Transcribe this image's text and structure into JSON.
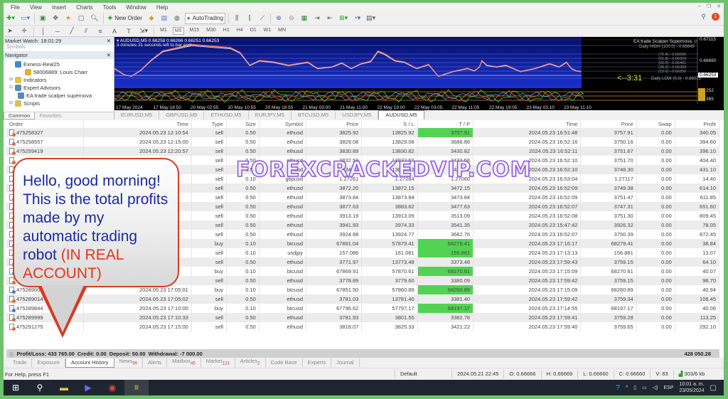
{
  "menu": [
    "File",
    "View",
    "Insert",
    "Charts",
    "Tools",
    "Window",
    "Help"
  ],
  "toolbar": {
    "new_order": "New Order",
    "auto_trading": "AutoTrading",
    "notification_count": "1"
  },
  "timeframes": [
    "M1",
    "M5",
    "M15",
    "M30",
    "H1",
    "H4",
    "D1",
    "W1",
    "MN"
  ],
  "active_timeframe": "M5",
  "market_watch": {
    "title": "Market Watch: 18:01:29",
    "tabs": [
      "Symbols",
      "Tick Chart"
    ]
  },
  "navigator": {
    "title": "Navigator",
    "items": [
      {
        "label": "Exness-Real25",
        "icon": "server-icon"
      },
      {
        "label": "58006889: Louis Charr",
        "icon": "account-icon"
      },
      {
        "label": "Indicators",
        "icon": "indicator-icon"
      },
      {
        "label": "Expert Advisors",
        "icon": "expert-icon"
      },
      {
        "label": "EA trade scalper supernova",
        "icon": "expert-icon"
      },
      {
        "label": "Scripts",
        "icon": "script-icon"
      }
    ],
    "tabs": [
      "Common",
      "Favorites"
    ]
  },
  "chart": {
    "header": "AUDUSD,M5  0.66258 0.66266 0.66251 0.66253",
    "subheader": "3 minutes 31 seconds left to bar end",
    "ea_label": "EA trade Scalper Supernova",
    "daily_high": "Daily HIGH (100.0) - 0.66849",
    "daily_low": "Daily LOW (0.0) - 0.66073",
    "fib_levels": [
      "(76.4) - 0.66666",
      "(61.8) - 0.66553",
      "(50.0) - 0.66461",
      "(38.2) - 0.66369",
      "(23.6) - 0.66256"
    ],
    "countdown": "<--3:31",
    "price_labels": [
      "0.67115",
      "0.66660",
      "0.66253"
    ],
    "current_price": "0.66253",
    "indicator_labels": [
      "252",
      "369"
    ],
    "time_labels": [
      "17 May 2024",
      "17 May 18:50",
      "20 May 02:55",
      "20 May 10:55",
      "20 May 18:55",
      "21 May 03:00",
      "21 May 11:00",
      "21 May 19:00",
      "22 May 03:05",
      "22 May 11:05",
      "22 May 19:05",
      "23 May 03:10",
      "23 May 11:10"
    ],
    "tabs": [
      "EURUSD,M5",
      "GBPUSD,M5",
      "ETHUSD,M5",
      "EURJPY,M5",
      "BTCUSD,M5",
      "USDJPY,M5",
      "AUDUSD,M5"
    ],
    "active_tab": "AUDUSD,M5"
  },
  "orders": {
    "columns": [
      "Order",
      "Time",
      "Type",
      "Size",
      "Symbol",
      "Price",
      "S / L",
      "T / P",
      "Time",
      "Price",
      "Swap",
      "Profit"
    ],
    "rows": [
      {
        "order": "475258327",
        "open_time": "2024.05.23 12:10:54",
        "type": "sell",
        "size": "0.50",
        "symbol": "ethusd",
        "price": "3825.92",
        "sl": "13825.92",
        "tp": "3757.91",
        "tp_hit": true,
        "close_time": "2024.05.23 16:51:48",
        "close_price": "3757.91",
        "swap": "0.00",
        "profit": "340.05"
      },
      {
        "order": "475258557",
        "open_time": "2024.05.23 12:15:00",
        "type": "sell",
        "size": "0.50",
        "symbol": "ethusd",
        "price": "3829.08",
        "sl": "13829.08",
        "tp": "3686.86",
        "tp_hit": false,
        "close_time": "2024.05.23 16:52:16",
        "close_price": "3750.16",
        "swap": "0.00",
        "profit": "394.60"
      },
      {
        "order": "475259419",
        "open_time": "2024.05.23 12:20:57",
        "type": "sell",
        "size": "0.50",
        "symbol": "ethusd",
        "price": "3830.89",
        "sl": "13830.82",
        "tp": "3430.82",
        "tp_hit": false,
        "close_time": "2024.05.23 16:52:11",
        "close_price": "3751.67",
        "swap": "0.00",
        "profit": "396.10"
      },
      {
        "order": "",
        "open_time": "",
        "type": "sell",
        "size": "0.50",
        "symbol": "ethusd",
        "price": "3832.58",
        "sl": "13832.58",
        "tp": "3432.58",
        "tp_hit": false,
        "close_time": "2024.05.23 16:52:10",
        "close_price": "3751.70",
        "swap": "0.00",
        "profit": "404.40"
      },
      {
        "order": "",
        "open_time": "",
        "type": "sell",
        "size": "0.50",
        "symbol": "ethusd",
        "price": "3834.52",
        "sl": "13834.52",
        "tp": "3434.52",
        "tp_hit": false,
        "close_time": "2024.05.23 16:52:10",
        "close_price": "3748.30",
        "swap": "0.00",
        "profit": "431.10"
      },
      {
        "order": "",
        "open_time": "",
        "type": "sell",
        "size": "0.10",
        "symbol": "gbpusd",
        "price": "1.27261",
        "sl": "1.27284",
        "tp": "1.27060",
        "tp_hit": false,
        "close_time": "2024.05.23 16:53:04",
        "close_price": "1.27117",
        "swap": "0.00",
        "profit": "14.40"
      },
      {
        "order": "",
        "open_time": "",
        "type": "sell",
        "size": "0.50",
        "symbol": "ethusd",
        "price": "3872.20",
        "sl": "13872.15",
        "tp": "3472.15",
        "tp_hit": false,
        "close_time": "2024.05.23 16:52:09",
        "close_price": "3749.38",
        "swap": "0.00",
        "profit": "614.10"
      },
      {
        "order": "",
        "open_time": "",
        "type": "sell",
        "size": "0.50",
        "symbol": "ethusd",
        "price": "3873.84",
        "sl": "13873.84",
        "tp": "3473.84",
        "tp_hit": false,
        "close_time": "2024.05.23 16:52:09",
        "close_price": "3751.47",
        "swap": "0.00",
        "profit": "611.85"
      },
      {
        "order": "",
        "open_time": "",
        "type": "sell",
        "size": "0.50",
        "symbol": "ethusd",
        "price": "3877.63",
        "sl": "3883.62",
        "tp": "3477.63",
        "tp_hit": false,
        "close_time": "2024.05.23 16:52:07",
        "close_price": "3747.31",
        "swap": "0.00",
        "profit": "651.60"
      },
      {
        "order": "",
        "open_time": "",
        "type": "sell",
        "size": "0.50",
        "symbol": "ethusd",
        "price": "3913.19",
        "sl": "13913.09",
        "tp": "3513.09",
        "tp_hit": false,
        "close_time": "2024.05.23 16:52:08",
        "close_price": "3751.30",
        "swap": "0.00",
        "profit": "809.45"
      },
      {
        "order": "",
        "open_time": "",
        "type": "sell",
        "size": "0.50",
        "symbol": "ethusd",
        "price": "3941.93",
        "sl": "3974.33",
        "tp": "3541.35",
        "tp_hit": false,
        "close_time": "2024.05.23 15:47:42",
        "close_price": "3926.32",
        "swap": "0.00",
        "profit": "78.05"
      },
      {
        "order": "",
        "open_time": "",
        "type": "sell",
        "size": "0.50",
        "symbol": "ethusd",
        "price": "3924.88",
        "sl": "13924.77",
        "tp": "3682.76",
        "tp_hit": false,
        "close_time": "2024.05.23 16:52:07",
        "close_price": "3750.39",
        "swap": "0.00",
        "profit": "872.45"
      },
      {
        "order": "",
        "open_time": "",
        "type": "buy",
        "size": "0.10",
        "symbol": "btcusd",
        "price": "67891.04",
        "sl": "57879.41",
        "tp": "68279.41",
        "tp_hit": true,
        "close_time": "2024.05.23 17:16:17",
        "close_price": "68279.41",
        "swap": "0.00",
        "profit": "38.84"
      },
      {
        "order": "",
        "open_time": "",
        "type": "sell",
        "size": "0.10",
        "symbol": "usdjpy",
        "price": "157.086",
        "sl": "161.081",
        "tp": "156.881",
        "tp_hit": true,
        "close_time": "2024.05.23 17:13:13",
        "close_price": "156.881",
        "swap": "0.00",
        "profit": "13.07"
      },
      {
        "order": "",
        "open_time": "",
        "type": "sell",
        "size": "0.50",
        "symbol": "ethusd",
        "price": "3771.97",
        "sl": "13773.48",
        "tp": "3373.48",
        "tp_hit": false,
        "close_time": "2024.05.23 17:59:43",
        "close_price": "3759.15",
        "swap": "0.00",
        "profit": "64.10"
      },
      {
        "order": "",
        "open_time": "",
        "type": "buy",
        "size": "0.10",
        "symbol": "btcusd",
        "price": "67869.91",
        "sl": "57870.61",
        "tp": "68270.61",
        "tp_hit": true,
        "close_time": "2024.05.23 17:15:09",
        "close_price": "68270.61",
        "swap": "0.00",
        "profit": "40.07"
      },
      {
        "order": "",
        "open_time": "",
        "type": "sell",
        "size": "0.50",
        "symbol": "ethusd",
        "price": "3778.89",
        "sl": "3779.60",
        "tp": "3380.09",
        "tp_hit": false,
        "close_time": "2024.05.23 17:59:42",
        "close_price": "3759.15",
        "swap": "0.00",
        "profit": "98.70"
      },
      {
        "order": "475289007",
        "open_time": "2024.05.23 17:05:01",
        "type": "buy",
        "size": "0.10",
        "symbol": "btcusd",
        "price": "67851.50",
        "sl": "57860.89",
        "tp": "68260.89",
        "tp_hit": true,
        "close_time": "2024.05.23 17:15:09",
        "close_price": "68260.89",
        "swap": "0.00",
        "profit": "40.94"
      },
      {
        "order": "475289014",
        "open_time": "2024.05.23 17:05:02",
        "type": "sell",
        "size": "0.50",
        "symbol": "ethusd",
        "price": "3781.03",
        "sl": "13781.40",
        "tp": "3381.40",
        "tp_hit": false,
        "close_time": "2024.05.23 17:59:42",
        "close_price": "3759.34",
        "swap": "0.00",
        "profit": "108.45"
      },
      {
        "order": "475289844",
        "open_time": "2024.05.23 17:10:00",
        "type": "buy",
        "size": "0.10",
        "symbol": "btcusd",
        "price": "67796.62",
        "sl": "57797.17",
        "tp": "68197.17",
        "tp_hit": true,
        "close_time": "2024.05.23 17:14:55",
        "close_price": "68197.17",
        "swap": "0.00",
        "profit": "40.06"
      },
      {
        "order": "475289999",
        "open_time": "2024.05.23 17:10:33",
        "type": "sell",
        "size": "0.50",
        "symbol": "ethusd",
        "price": "3781.93",
        "sl": "3801.55",
        "tp": "3382.78",
        "tp_hit": false,
        "close_time": "2024.05.23 17:59:41",
        "close_price": "3759.28",
        "swap": "0.00",
        "profit": "113.25"
      },
      {
        "order": "475291275",
        "open_time": "2024.05.23 17:15:00",
        "type": "sell",
        "size": "0.50",
        "symbol": "ethusd",
        "price": "3818.07",
        "sl": "3825.33",
        "tp": "3421.22",
        "tp_hit": false,
        "close_time": "2024.05.23 17:59:40",
        "close_price": "3759.65",
        "swap": "0.00",
        "profit": "292.10"
      }
    ],
    "summary": {
      "profit_loss": "Profit/Loss: 433 765.00",
      "credit": "Credit: 0.00",
      "deposit": "Deposit:   50.00",
      "withdrawal": "Withdrawal: -7 000.00",
      "total": "428 050.28"
    }
  },
  "terminal_tabs": [
    {
      "label": "Trade",
      "count": ""
    },
    {
      "label": "Exposure",
      "count": ""
    },
    {
      "label": "Account History",
      "count": "",
      "active": true
    },
    {
      "label": "News",
      "count": "99"
    },
    {
      "label": "Alerts",
      "count": ""
    },
    {
      "label": "Mailbox",
      "count": "45"
    },
    {
      "label": "Market",
      "count": "123"
    },
    {
      "label": "Articles",
      "count": "2"
    },
    {
      "label": "Code Base",
      "count": ""
    },
    {
      "label": "Experts",
      "count": ""
    },
    {
      "label": "Journal",
      "count": ""
    }
  ],
  "statusbar": {
    "help": "For Help, press F1",
    "profile": "Default",
    "bar_time": "2024.05.21 22:45",
    "open": "O: 0.66666",
    "high": "H: 0.66669",
    "low": "L: 0.66660",
    "close": "C: 0.66660",
    "volume": "V: 83",
    "traffic": "303/6 kb"
  },
  "overlay": {
    "bubble_text": "Hello, good morning! This is the total profits made by my automatic trading robot ",
    "bubble_highlight": "(IN REAL ACCOUNT)",
    "watermark": "FOREXCRACKEDVIP.COM"
  },
  "taskbar": {
    "language": "ESP",
    "time": "10:01 a. m.",
    "date": "23/05/2024"
  }
}
